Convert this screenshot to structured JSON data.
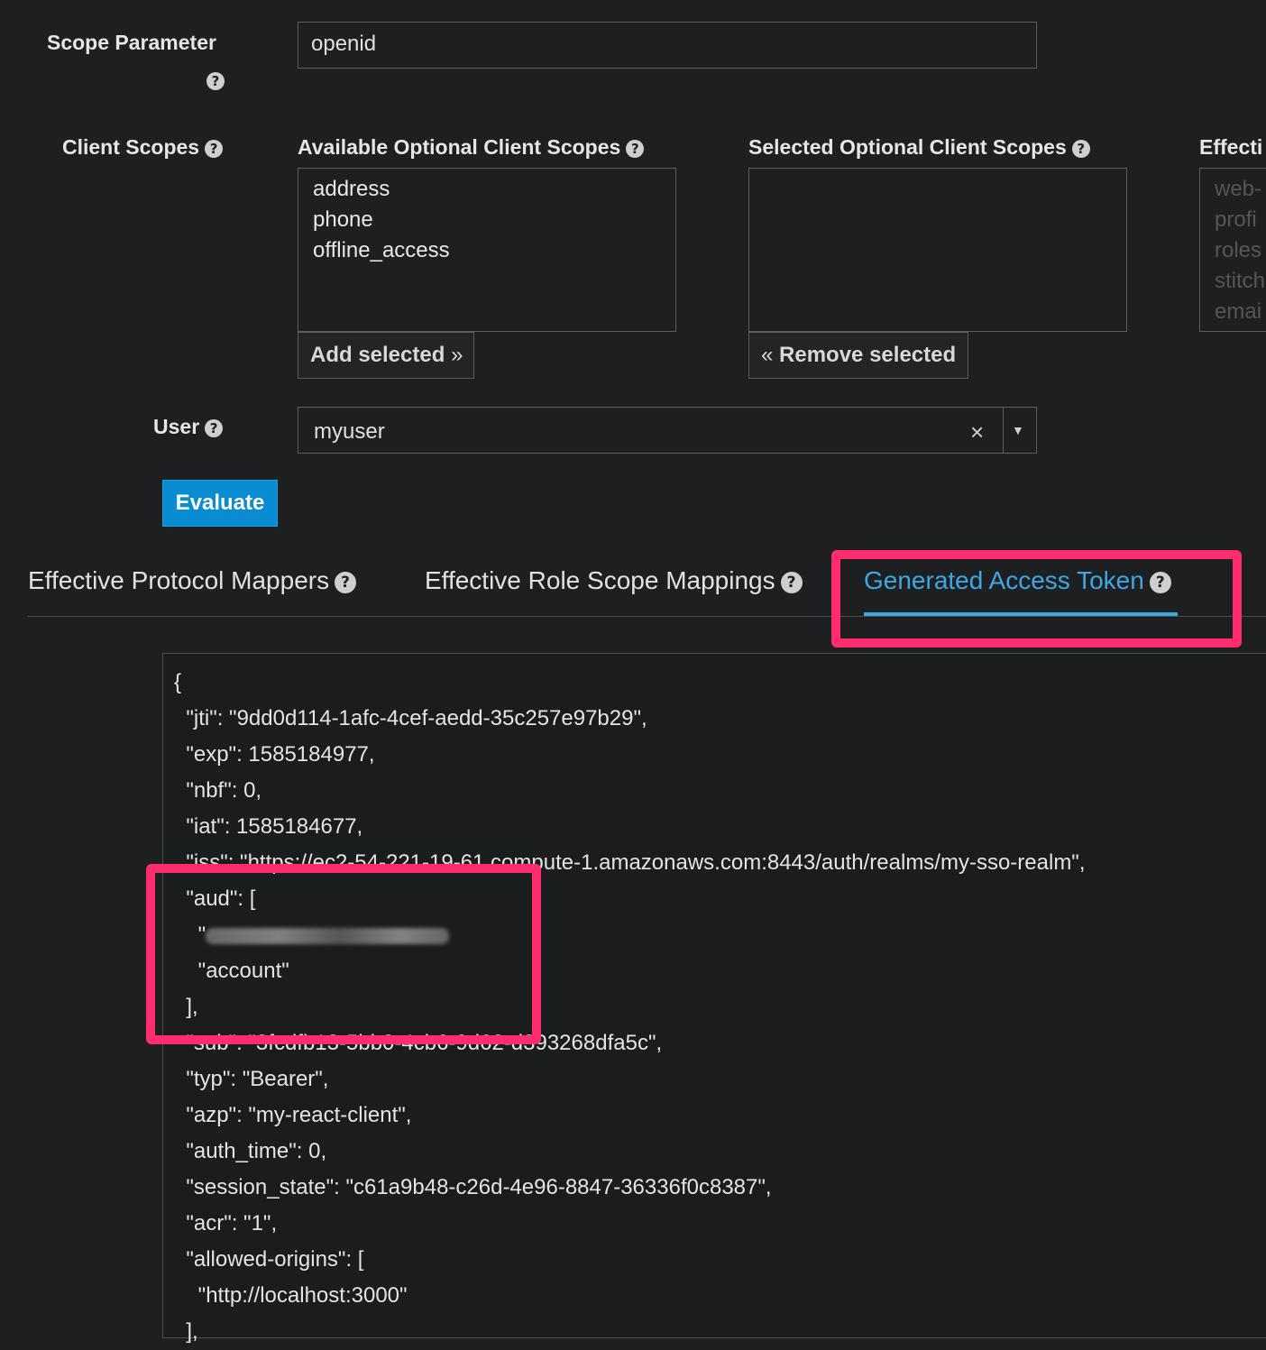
{
  "scope": {
    "label": "Scope Parameter",
    "value": "openid",
    "help_icon": "question-circle-icon"
  },
  "client_scopes": {
    "label": "Client Scopes",
    "available": {
      "label": "Available Optional Client Scopes",
      "items": [
        "address",
        "phone",
        "offline_access"
      ],
      "button_label": "Add selected",
      "button_icon": "»"
    },
    "selected": {
      "label": "Selected Optional Client Scopes",
      "items": [],
      "button_label": "Remove selected",
      "button_icon": "«"
    },
    "effective": {
      "label": "Effecti",
      "items": [
        "web-",
        "profi",
        "roles",
        "stitch",
        "emai"
      ]
    }
  },
  "user": {
    "label": "User",
    "value": "myuser",
    "clear_icon": "×",
    "dropdown_icon": "▼"
  },
  "evaluate_button": "Evaluate",
  "tabs": [
    {
      "label": "Effective Protocol Mappers",
      "active": false
    },
    {
      "label": "Effective Role Scope Mappings",
      "active": false
    },
    {
      "label": "Generated Access Token",
      "active": true
    }
  ],
  "token_lines": [
    "{",
    "  \"jti\": \"9dd0d114-1afc-4cef-aedd-35c257e97b29\",",
    "  \"exp\": 1585184977,",
    "  \"nbf\": 0,",
    "  \"iat\": 1585184677,",
    "  \"iss\": \"https://ec2-54-221-19-61.compute-1.amazonaws.com:8443/auth/realms/my-sso-realm\",",
    "  \"aud\": [",
    "    \"",
    "    \"account\"",
    "  ],",
    "  \"sub\": \"3fcdfb13-5bb0-4cb6-9d62-d393268dfa5c\",",
    "  \"typ\": \"Bearer\",",
    "  \"azp\": \"my-react-client\",",
    "  \"auth_time\": 0,",
    "  \"session_state\": \"c61a9b48-c26d-4e96-8847-36336f0c8387\",",
    "  \"acr\": \"1\",",
    "  \"allowed-origins\": [",
    "    \"http://localhost:3000\"",
    "  ],"
  ],
  "colors": {
    "background": "#1e1f21",
    "accent": "#3fa7e4",
    "primary_button": "#0a8cd2",
    "highlight": "#ff2d6e"
  }
}
